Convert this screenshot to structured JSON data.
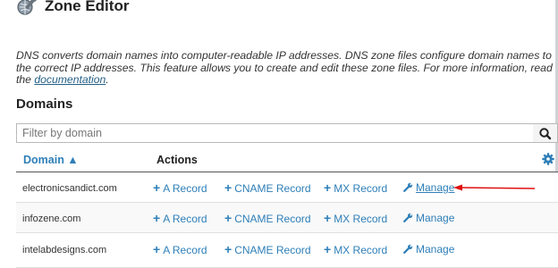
{
  "app": {
    "title": "Zone Editor",
    "icon": "zone-editor-icon"
  },
  "description": {
    "text": "DNS converts domain names into computer-readable IP addresses. DNS zone files configure domain names to the correct IP addresses. This feature allows you to create and edit these zone files. For more information, read the ",
    "link_text": "documentation",
    "end": "."
  },
  "domains": {
    "title": "Domains",
    "filter_placeholder": "Filter by domain",
    "search_icon": "search-icon",
    "columns": {
      "domain": "Domain ▲",
      "actions": "Actions"
    },
    "settings_icon": "gear-icon",
    "rows": [
      {
        "domain": "electronicsandict.com",
        "a_record": "A Record",
        "cname_record": "CNAME Record",
        "mx_record": "MX Record",
        "manage": "Manage"
      },
      {
        "domain": "infozene.com",
        "a_record": "A Record",
        "cname_record": "CNAME Record",
        "mx_record": "MX Record",
        "manage": "Manage"
      },
      {
        "domain": "intelabdesigns.com",
        "a_record": "A Record",
        "cname_record": "CNAME Record",
        "mx_record": "MX Record",
        "manage": "Manage"
      }
    ]
  },
  "colors": {
    "link": "#2e7fb8",
    "annotation_arrow": "#e01010",
    "header_text": "#222222"
  }
}
